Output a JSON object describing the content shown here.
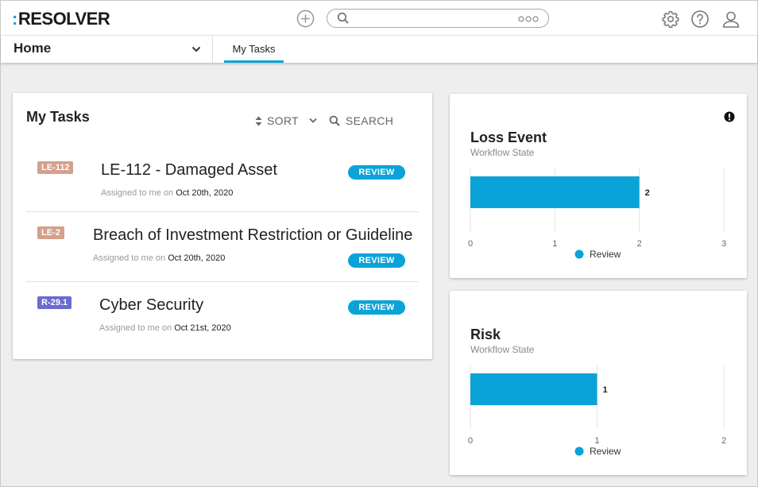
{
  "header": {
    "logo_text": "RESOLVER",
    "logo_dots": ":",
    "search_placeholder": "",
    "accent_color": "#0aa3d8"
  },
  "nav": {
    "home_label": "Home",
    "tab_label": "My Tasks"
  },
  "tasks_panel": {
    "title": "My Tasks",
    "sort_label": "SORT",
    "search_label": "SEARCH",
    "tasks": [
      {
        "badge": "LE-112",
        "badge_color": "#d4a08c",
        "name": "LE-112 - Damaged Asset",
        "assigned_prefix": "Assigned to me on",
        "date": "Oct 20th, 2020",
        "status": "REVIEW"
      },
      {
        "badge": "LE-2",
        "badge_color": "#d4a08c",
        "name": "Breach of Investment Restriction or Guideline",
        "assigned_prefix": "Assigned to me on",
        "date": "Oct 20th, 2020",
        "status": "REVIEW"
      },
      {
        "badge": "R-29.1",
        "badge_color": "#6b6ad0",
        "name": "Cyber Security",
        "assigned_prefix": "Assigned to me on",
        "date": "Oct 21st, 2020",
        "status": "REVIEW"
      }
    ]
  },
  "chart_data": [
    {
      "type": "bar",
      "orientation": "horizontal",
      "title": "Loss Event",
      "subtitle": "Workflow State",
      "categories": [
        ""
      ],
      "series": [
        {
          "name": "Review",
          "values": [
            2
          ],
          "color": "#0aa3d8"
        }
      ],
      "data_labels": [
        "2"
      ],
      "xlim": [
        0,
        3
      ],
      "xticks": [
        "0",
        "1",
        "2",
        "3"
      ],
      "grid": true,
      "legend": "bottom"
    },
    {
      "type": "bar",
      "orientation": "horizontal",
      "title": "Risk",
      "subtitle": "Workflow State",
      "categories": [
        ""
      ],
      "series": [
        {
          "name": "Review",
          "values": [
            1
          ],
          "color": "#0aa3d8"
        }
      ],
      "data_labels": [
        "1"
      ],
      "xlim": [
        0,
        2
      ],
      "xticks": [
        "0",
        "1",
        "2"
      ],
      "grid": true,
      "legend": "bottom"
    }
  ]
}
